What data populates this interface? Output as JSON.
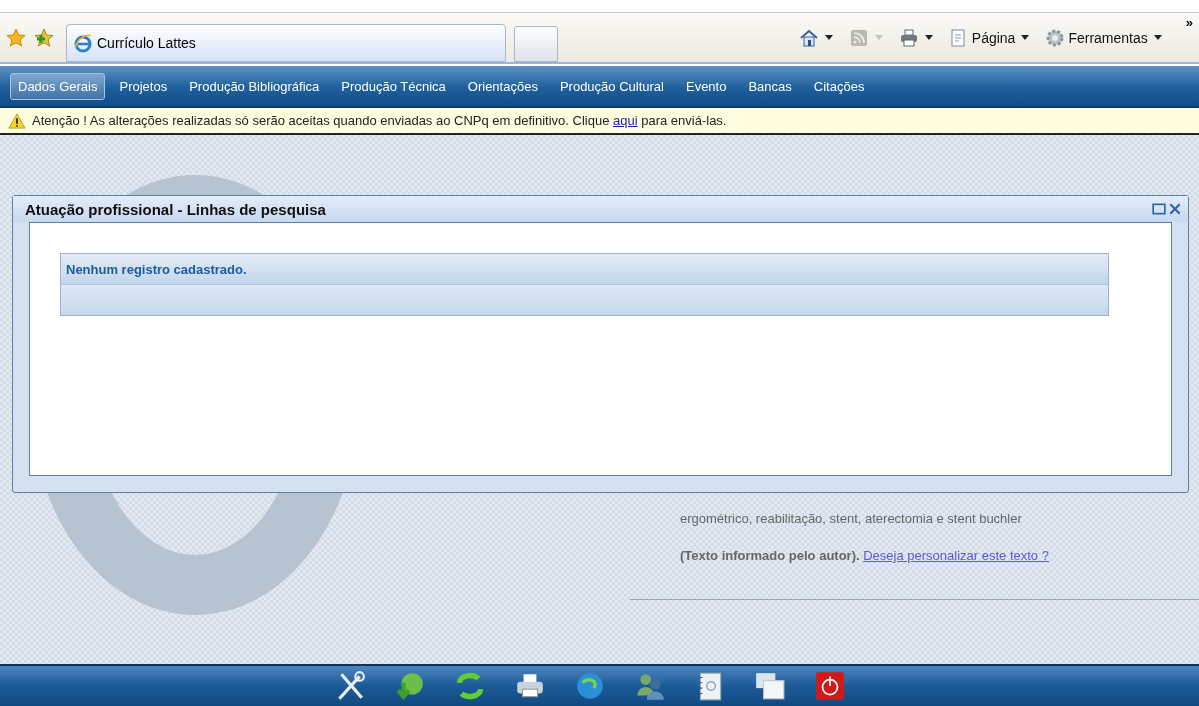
{
  "browser": {
    "tab_title": "Currículo Lattes",
    "commands": [
      {
        "kind": "home"
      },
      {
        "kind": "feed"
      },
      {
        "kind": "print"
      },
      {
        "kind": "page",
        "label": "Página"
      },
      {
        "kind": "tools",
        "label": "Ferramentas"
      }
    ],
    "overflow": "»"
  },
  "nav": [
    {
      "label": "Dados Gerais",
      "selected": true
    },
    {
      "label": "Projetos",
      "selected": false
    },
    {
      "label": "Produção Bibliográfica",
      "selected": false
    },
    {
      "label": "Produção Técnica",
      "selected": false
    },
    {
      "label": "Orientações",
      "selected": false
    },
    {
      "label": "Produção Cultural",
      "selected": false
    },
    {
      "label": "Evento",
      "selected": false
    },
    {
      "label": "Bancas",
      "selected": false
    },
    {
      "label": "Citações",
      "selected": false
    }
  ],
  "warning": {
    "before": "Atenção ! As alterações realizadas só serão aceitas quando enviadas ao CNPq em definitivo. Clique",
    "link": "aqui",
    "after": "para enviá-las."
  },
  "dialog": {
    "title": "Atuação profissional - Linhas de pesquisa",
    "empty_message": "Nenhum registro cadastrado."
  },
  "background_text": {
    "keywords": "ergométrico, reabilitação, stent, aterectomia e stent buchler",
    "note": "(Texto informado pelo autor).",
    "link": "Deseja personalizar este texto ?"
  },
  "toolbar": [
    {
      "kind": "tools"
    },
    {
      "kind": "download"
    },
    {
      "kind": "sync"
    },
    {
      "kind": "print"
    },
    {
      "kind": "globe"
    },
    {
      "kind": "users"
    },
    {
      "kind": "address-book"
    },
    {
      "kind": "windows"
    },
    {
      "kind": "power"
    }
  ]
}
